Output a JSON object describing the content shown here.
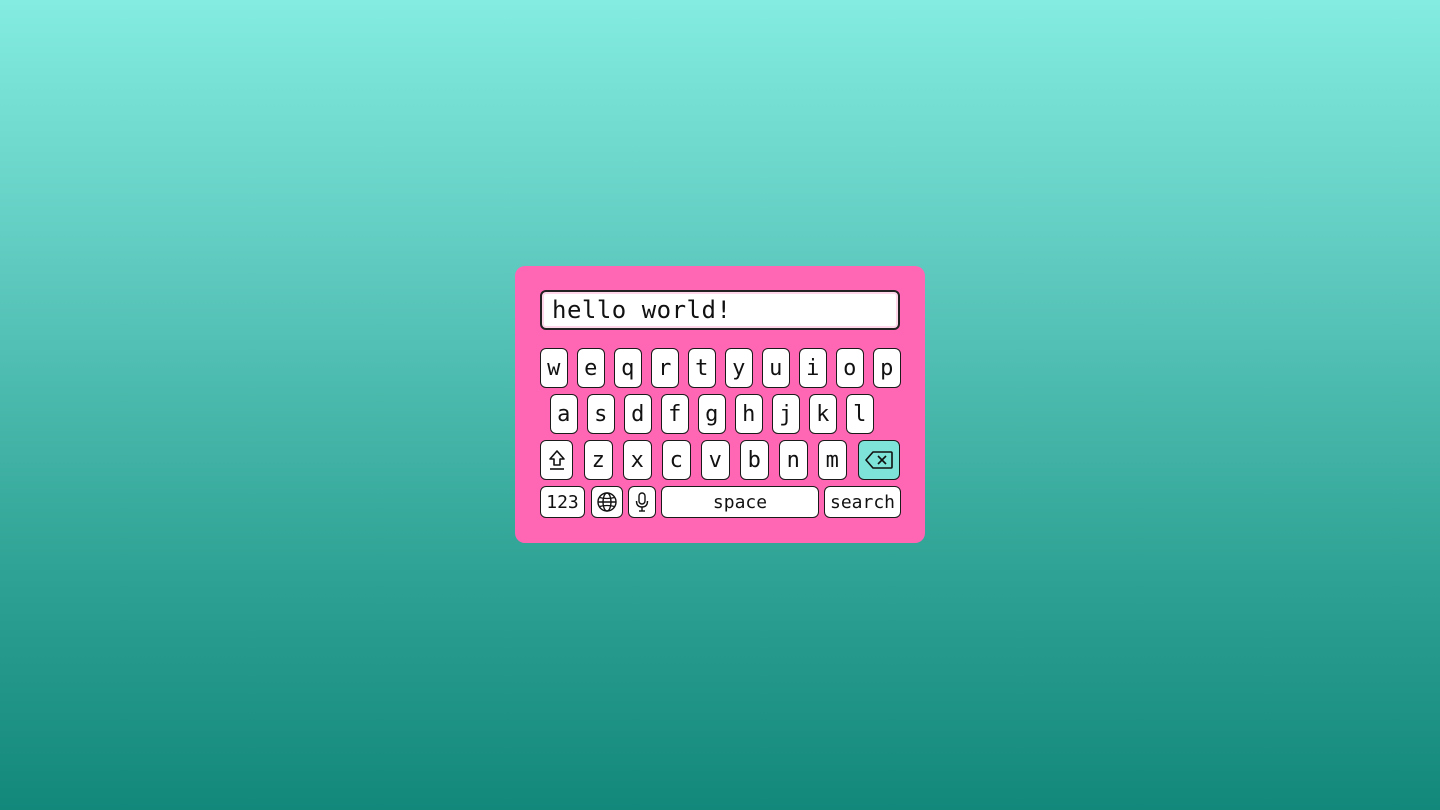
{
  "search_field": {
    "value": "hello world!"
  },
  "keyboard": {
    "row1": [
      "w",
      "e",
      "q",
      "r",
      "t",
      "y",
      "u",
      "i",
      "o",
      "p"
    ],
    "row2": [
      "a",
      "s",
      "d",
      "f",
      "g",
      "h",
      "j",
      "k",
      "l"
    ],
    "row3": [
      "z",
      "x",
      "c",
      "v",
      "b",
      "n",
      "m"
    ],
    "shift_icon": "shift-arrow-icon",
    "backspace_icon": "backspace-icon",
    "numbers_label": "123",
    "globe_icon": "globe-icon",
    "mic_icon": "microphone-icon",
    "space_label": "space",
    "search_label": "search"
  },
  "colors": {
    "keyboard_bg": "#ff66b3",
    "backspace_bg": "#7ee3d8",
    "background_top": "#84ece0",
    "background_bottom": "#12887b"
  }
}
